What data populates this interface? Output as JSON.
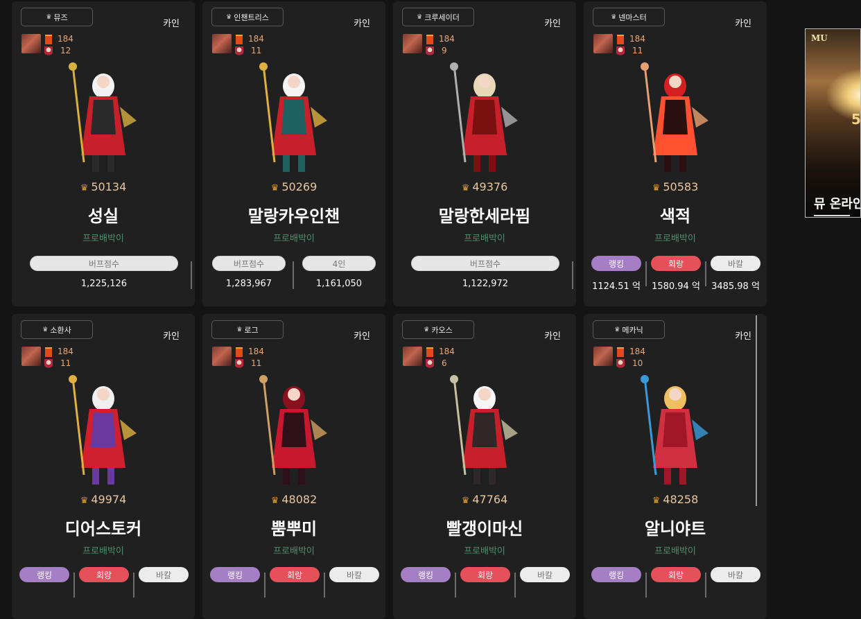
{
  "cards": [
    {
      "job": "뮤즈",
      "server": "카인",
      "fame": "184",
      "level": "12",
      "score": "50134",
      "name": "성실",
      "guild": "프로배박이",
      "stats": [
        {
          "label": "버프점수",
          "value": "1,225,126"
        }
      ]
    },
    {
      "job": "인챈트리스",
      "server": "카인",
      "fame": "184",
      "level": "11",
      "score": "50269",
      "name": "말랑카우인챈",
      "guild": "프로배박이",
      "stats": [
        {
          "label": "버프점수",
          "value": "1,283,967"
        },
        {
          "label": "4인",
          "value": "1,161,050"
        }
      ]
    },
    {
      "job": "크루세이더",
      "server": "카인",
      "fame": "184",
      "level": "9",
      "score": "49376",
      "name": "말랑한세라핌",
      "guild": "프로배박이",
      "stats": [
        {
          "label": "버프점수",
          "value": "1,122,972"
        }
      ]
    },
    {
      "job": "넨마스터",
      "server": "카인",
      "fame": "184",
      "level": "11",
      "score": "50583",
      "name": "색적",
      "guild": "프로배박이",
      "stats": [
        {
          "label": "랭킹",
          "value": "1124.51 억"
        },
        {
          "label": "회랑",
          "value": "1580.94 억"
        },
        {
          "label": "바칼",
          "value": "3485.98 억"
        }
      ]
    },
    {
      "job": "소환사",
      "server": "카인",
      "fame": "184",
      "level": "11",
      "score": "49974",
      "name": "디어스토커",
      "guild": "프로배박이",
      "stats": [
        {
          "label": "랭킹",
          "value": ""
        },
        {
          "label": "회랑",
          "value": ""
        },
        {
          "label": "바칼",
          "value": ""
        }
      ]
    },
    {
      "job": "로그",
      "server": "카인",
      "fame": "184",
      "level": "11",
      "score": "48082",
      "name": "뿜뿌미",
      "guild": "프로배박이",
      "stats": [
        {
          "label": "랭킹",
          "value": ""
        },
        {
          "label": "회랑",
          "value": ""
        },
        {
          "label": "바칼",
          "value": ""
        }
      ]
    },
    {
      "job": "카오스",
      "server": "카인",
      "fame": "184",
      "level": "6",
      "score": "47764",
      "name": "빨갱이마신",
      "guild": "프로배박이",
      "stats": [
        {
          "label": "랭킹",
          "value": ""
        },
        {
          "label": "회랑",
          "value": ""
        },
        {
          "label": "바칼",
          "value": ""
        }
      ]
    },
    {
      "job": "메카닉",
      "server": "카인",
      "fame": "184",
      "level": "10",
      "score": "48258",
      "name": "알니야트",
      "guild": "프로배박이",
      "stats": [
        {
          "label": "랭킹",
          "value": ""
        },
        {
          "label": "회랑",
          "value": ""
        },
        {
          "label": "바칼",
          "value": ""
        }
      ]
    }
  ],
  "ad": {
    "logo": "MU",
    "number": "5",
    "text": "뮤 온라인"
  },
  "colors": {
    "background": "#141414",
    "card": "#202020",
    "score": "#e8c7a1",
    "guild": "#4f8f6e",
    "ranking": "#a57ec6",
    "corridor": "#e5505a",
    "bakal": "#ececec"
  }
}
